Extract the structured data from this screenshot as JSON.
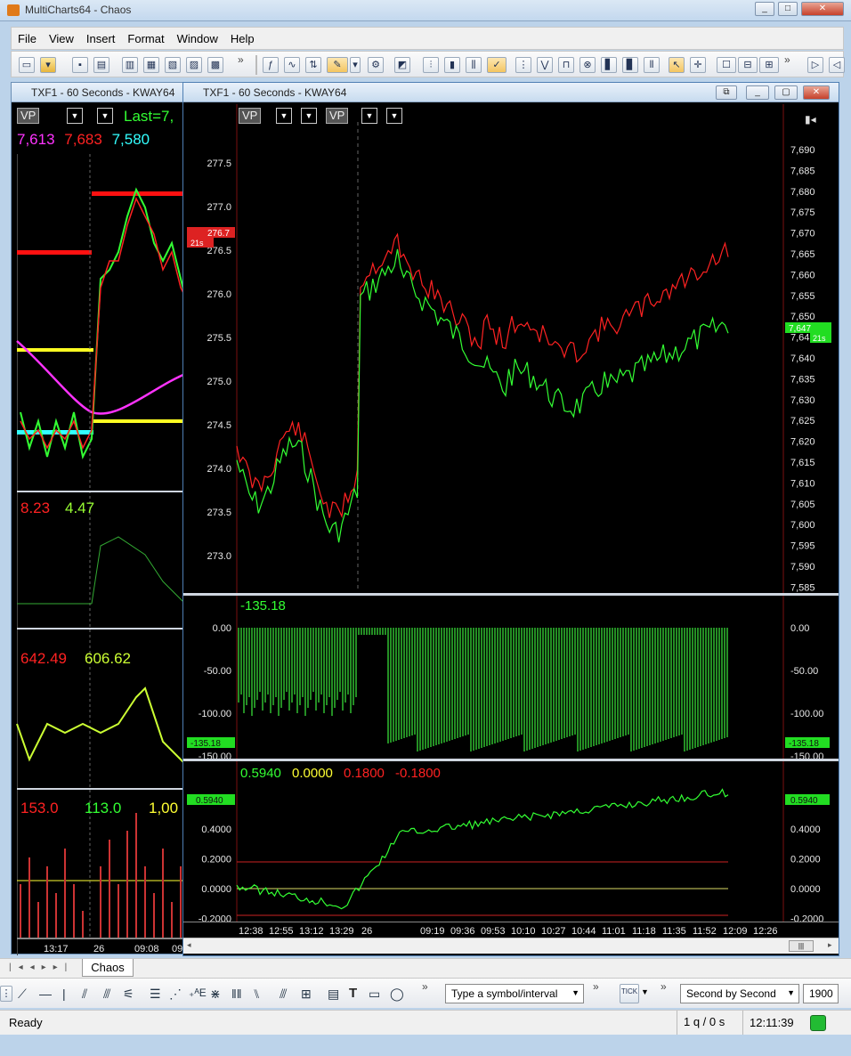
{
  "app": {
    "title": "MultiCharts64 - Chaos"
  },
  "menu": [
    "File",
    "View",
    "Insert",
    "Format",
    "Window",
    "Help"
  ],
  "left_window": {
    "title": "TXF1 - 60 Seconds - KWAY64",
    "vp_label": "VP",
    "last_label": "Last=7,",
    "prices": [
      "7,613",
      "7,683",
      "7,580"
    ],
    "panel2_values": [
      "8.23",
      "4.47"
    ],
    "panel3_values": [
      "642.49",
      "606.62"
    ],
    "panel4_values": [
      "153.0",
      "113.0",
      "1,00"
    ],
    "time_labels": [
      "13:17",
      "26",
      "09:08",
      "09:2"
    ]
  },
  "main_window": {
    "title": "TXF1 - 60 Seconds - KWAY64",
    "vp_label_1": "VP",
    "vp_label_2": "VP",
    "left_axis": [
      "277.5",
      "277.0",
      "276.5",
      "276.0",
      "275.5",
      "275.0",
      "274.5",
      "274.0",
      "273.5",
      "273.0"
    ],
    "left_marker": "276.7",
    "left_marker_sub": "21s",
    "right_axis": [
      "7,690",
      "7,685",
      "7,680",
      "7,675",
      "7,670",
      "7,665",
      "7,660",
      "7,655",
      "7,650",
      "7,645",
      "7,640",
      "7,635",
      "7,630",
      "7,625",
      "7,620",
      "7,615",
      "7,610",
      "7,605",
      "7,600",
      "7,595",
      "7,590",
      "7,585"
    ],
    "right_marker": "7,647",
    "right_marker_sub": "21s",
    "panel2": {
      "value": "-135.18",
      "left_axis": [
        "0.00",
        "-50.00",
        "-100.00",
        "-150.00"
      ],
      "right_axis": [
        "0.00",
        "-50.00",
        "-100.00",
        "-150.00"
      ],
      "marker": "-135.18"
    },
    "panel3": {
      "values": [
        "0.5940",
        "0.0000",
        "0.1800",
        "-0.1800"
      ],
      "left_axis": [
        "0.4000",
        "0.2000",
        "0.0000",
        "-0.2000"
      ],
      "right_axis": [
        "0.4000",
        "0.2000",
        "0.0000",
        "-0.2000"
      ],
      "marker": "0.5940"
    },
    "time_axis": [
      "12:38",
      "12:55",
      "13:12",
      "13:29",
      "26",
      "09:19",
      "09:36",
      "09:53",
      "10:10",
      "10:27",
      "10:44",
      "11:01",
      "11:18",
      "11:35",
      "11:52",
      "12:09",
      "12:26"
    ]
  },
  "sheet_tab": "Chaos",
  "symbol_input": {
    "placeholder": "Type a symbol/interval"
  },
  "mode_select": "Second by Second",
  "bars_input": "1900",
  "status": {
    "ready": "Ready",
    "queue": "1 q / 0 s",
    "clock": "12:11:39"
  },
  "colors": {
    "bg": "#000000",
    "red": "#ff2222",
    "green": "#33ff33",
    "yellow": "#ffff33",
    "cyan": "#33ffff",
    "magenta": "#ff33ff"
  }
}
